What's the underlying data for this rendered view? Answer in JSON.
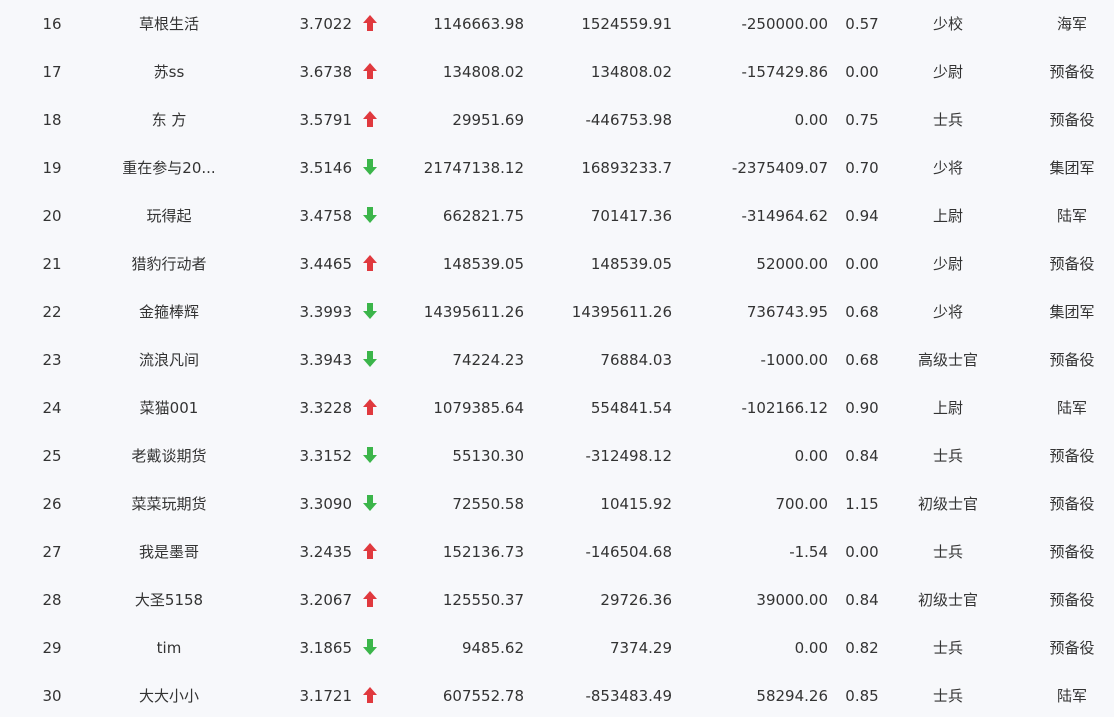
{
  "colors": {
    "background": "#f7f8fb",
    "text": "#333333",
    "up": "#e0393e",
    "down": "#3bb54a"
  },
  "rows": [
    {
      "rank": "16",
      "name": "草根生活",
      "score": "3.7022",
      "trend": "up",
      "v1": "1146663.98",
      "v2": "1524559.91",
      "v3": "-250000.00",
      "ratio": "0.57",
      "military_rank": "少校",
      "branch": "海军"
    },
    {
      "rank": "17",
      "name": "苏ss",
      "score": "3.6738",
      "trend": "up",
      "v1": "134808.02",
      "v2": "134808.02",
      "v3": "-157429.86",
      "ratio": "0.00",
      "military_rank": "少尉",
      "branch": "预备役"
    },
    {
      "rank": "18",
      "name": "东 方",
      "score": "3.5791",
      "trend": "up",
      "v1": "29951.69",
      "v2": "-446753.98",
      "v3": "0.00",
      "ratio": "0.75",
      "military_rank": "士兵",
      "branch": "预备役"
    },
    {
      "rank": "19",
      "name": "重在参与20...",
      "score": "3.5146",
      "trend": "down",
      "v1": "21747138.12",
      "v2": "16893233.7",
      "v3": "-2375409.07",
      "ratio": "0.70",
      "military_rank": "少将",
      "branch": "集团军"
    },
    {
      "rank": "20",
      "name": "玩得起",
      "score": "3.4758",
      "trend": "down",
      "v1": "662821.75",
      "v2": "701417.36",
      "v3": "-314964.62",
      "ratio": "0.94",
      "military_rank": "上尉",
      "branch": "陆军"
    },
    {
      "rank": "21",
      "name": "猎豹行动者",
      "score": "3.4465",
      "trend": "up",
      "v1": "148539.05",
      "v2": "148539.05",
      "v3": "52000.00",
      "ratio": "0.00",
      "military_rank": "少尉",
      "branch": "预备役"
    },
    {
      "rank": "22",
      "name": "金箍棒辉",
      "score": "3.3993",
      "trend": "down",
      "v1": "14395611.26",
      "v2": "14395611.26",
      "v3": "736743.95",
      "ratio": "0.68",
      "military_rank": "少将",
      "branch": "集团军"
    },
    {
      "rank": "23",
      "name": "流浪凡间",
      "score": "3.3943",
      "trend": "down",
      "v1": "74224.23",
      "v2": "76884.03",
      "v3": "-1000.00",
      "ratio": "0.68",
      "military_rank": "高级士官",
      "branch": "预备役"
    },
    {
      "rank": "24",
      "name": "菜猫001",
      "score": "3.3228",
      "trend": "up",
      "v1": "1079385.64",
      "v2": "554841.54",
      "v3": "-102166.12",
      "ratio": "0.90",
      "military_rank": "上尉",
      "branch": "陆军"
    },
    {
      "rank": "25",
      "name": "老戴谈期货",
      "score": "3.3152",
      "trend": "down",
      "v1": "55130.30",
      "v2": "-312498.12",
      "v3": "0.00",
      "ratio": "0.84",
      "military_rank": "士兵",
      "branch": "预备役"
    },
    {
      "rank": "26",
      "name": "菜菜玩期货",
      "score": "3.3090",
      "trend": "down",
      "v1": "72550.58",
      "v2": "10415.92",
      "v3": "700.00",
      "ratio": "1.15",
      "military_rank": "初级士官",
      "branch": "预备役"
    },
    {
      "rank": "27",
      "name": "我是墨哥",
      "score": "3.2435",
      "trend": "up",
      "v1": "152136.73",
      "v2": "-146504.68",
      "v3": "-1.54",
      "ratio": "0.00",
      "military_rank": "士兵",
      "branch": "预备役"
    },
    {
      "rank": "28",
      "name": "大圣5158",
      "score": "3.2067",
      "trend": "up",
      "v1": "125550.37",
      "v2": "29726.36",
      "v3": "39000.00",
      "ratio": "0.84",
      "military_rank": "初级士官",
      "branch": "预备役"
    },
    {
      "rank": "29",
      "name": "tim",
      "score": "3.1865",
      "trend": "down",
      "v1": "9485.62",
      "v2": "7374.29",
      "v3": "0.00",
      "ratio": "0.82",
      "military_rank": "士兵",
      "branch": "预备役"
    },
    {
      "rank": "30",
      "name": "大大小小",
      "score": "3.1721",
      "trend": "up",
      "v1": "607552.78",
      "v2": "-853483.49",
      "v3": "58294.26",
      "ratio": "0.85",
      "military_rank": "士兵",
      "branch": "陆军"
    }
  ]
}
